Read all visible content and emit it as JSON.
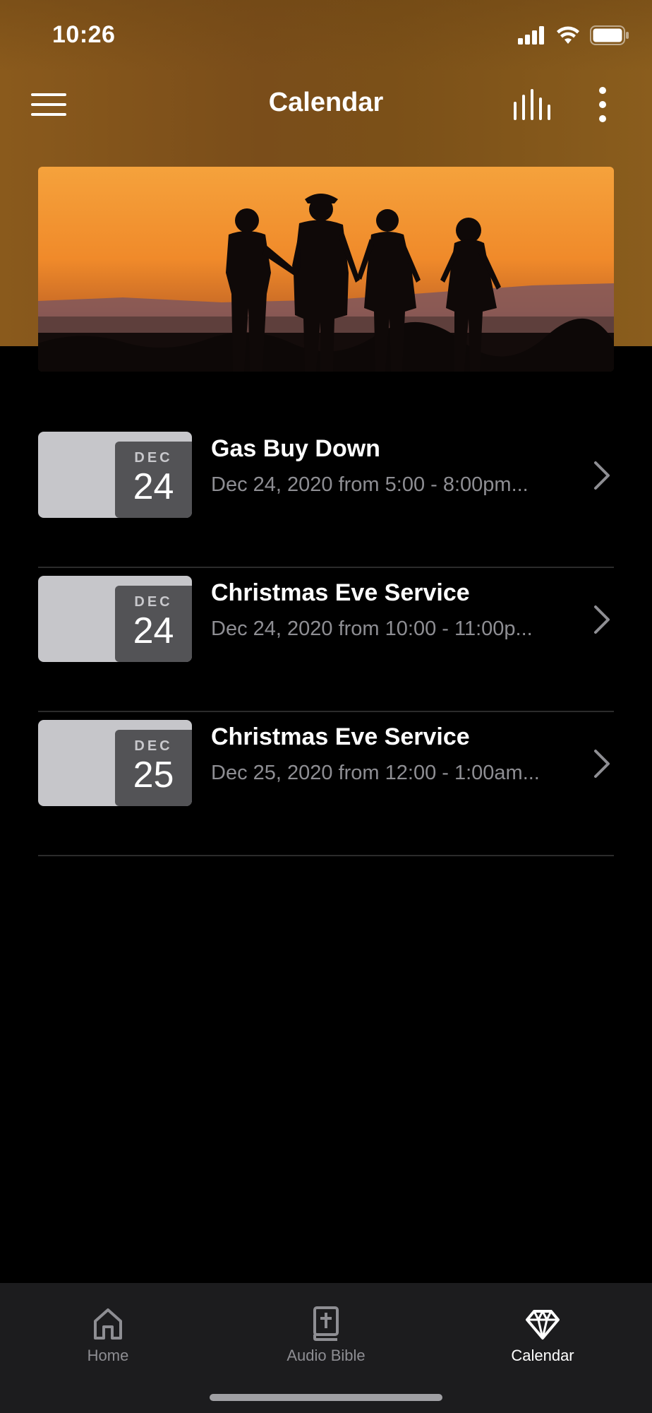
{
  "status_bar": {
    "time": "10:26"
  },
  "header": {
    "title": "Calendar",
    "icons": [
      "menu-icon",
      "bar-chart-icon",
      "more-vertical-icon"
    ]
  },
  "hero": {
    "image": "family silhouette at sunset"
  },
  "events": [
    {
      "month": "DEC",
      "day": "24",
      "title": "Gas Buy Down",
      "subtitle": "Dec 24, 2020 from 5:00 - 8:00pm..."
    },
    {
      "month": "DEC",
      "day": "24",
      "title": "Christmas Eve Service",
      "subtitle": "Dec 24, 2020 from 10:00 - 11:00p..."
    },
    {
      "month": "DEC",
      "day": "25",
      "title": "Christmas Eve Service",
      "subtitle": "Dec 25, 2020 from 12:00 - 1:00am..."
    }
  ],
  "tab_bar": {
    "tabs": [
      {
        "label": "Home",
        "icon": "home-icon"
      },
      {
        "label": "Audio Bible",
        "icon": "bible-icon"
      },
      {
        "label": "Calendar",
        "icon": "diamond-icon",
        "active": true
      }
    ]
  },
  "colors": {
    "header_bg": "#7a4d1a",
    "background": "#000000",
    "tab_bar_bg": "#1c1c1e",
    "date_badge_bg": "#535356",
    "thumb_bg": "#c6c6ca",
    "muted_text": "#8e8e93"
  }
}
